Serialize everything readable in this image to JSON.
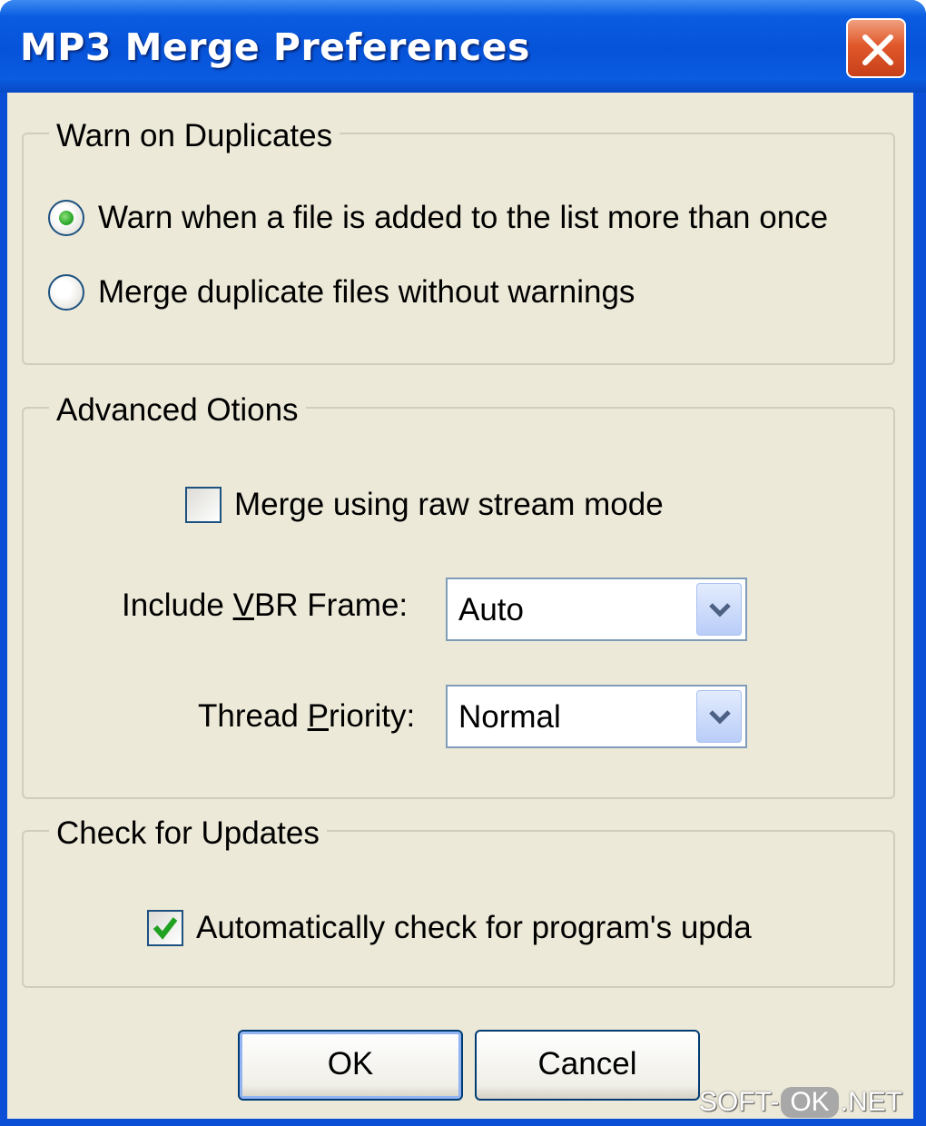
{
  "window": {
    "title": "MP3 Merge Preferences"
  },
  "duplicates": {
    "legend": "Warn on Duplicates",
    "options": [
      {
        "label": "Warn when a file is added to the list more than once",
        "selected": true
      },
      {
        "label": "Merge duplicate files without warnings",
        "selected": false
      }
    ]
  },
  "advanced": {
    "legend": "Advanced Otions",
    "raw_stream": {
      "label": "Merge using raw stream mode",
      "checked": false
    },
    "vbr": {
      "label_prefix": "Include ",
      "label_accel": "V",
      "label_suffix": "BR Frame:",
      "value": "Auto"
    },
    "priority": {
      "label_prefix": "Thread ",
      "label_accel": "P",
      "label_suffix": "riority:",
      "value": "Normal"
    }
  },
  "updates": {
    "legend": "Check for Updates",
    "auto_check": {
      "label": "Automatically check for program's upda",
      "checked": true
    }
  },
  "buttons": {
    "ok": "OK",
    "cancel": "Cancel"
  },
  "watermark": {
    "prefix": "SOFT-",
    "mid": "OK",
    "suffix": ".NET"
  },
  "colors": {
    "titlebar": "#0653d9",
    "dialog_bg": "#ece9d8",
    "close_button": "#e0582a",
    "check_green": "#21a121"
  },
  "icons": {
    "close": "close-icon",
    "radio_dot": "radio-dot-icon",
    "checkmark": "checkmark-icon",
    "dropdown": "chevron-down-icon"
  }
}
